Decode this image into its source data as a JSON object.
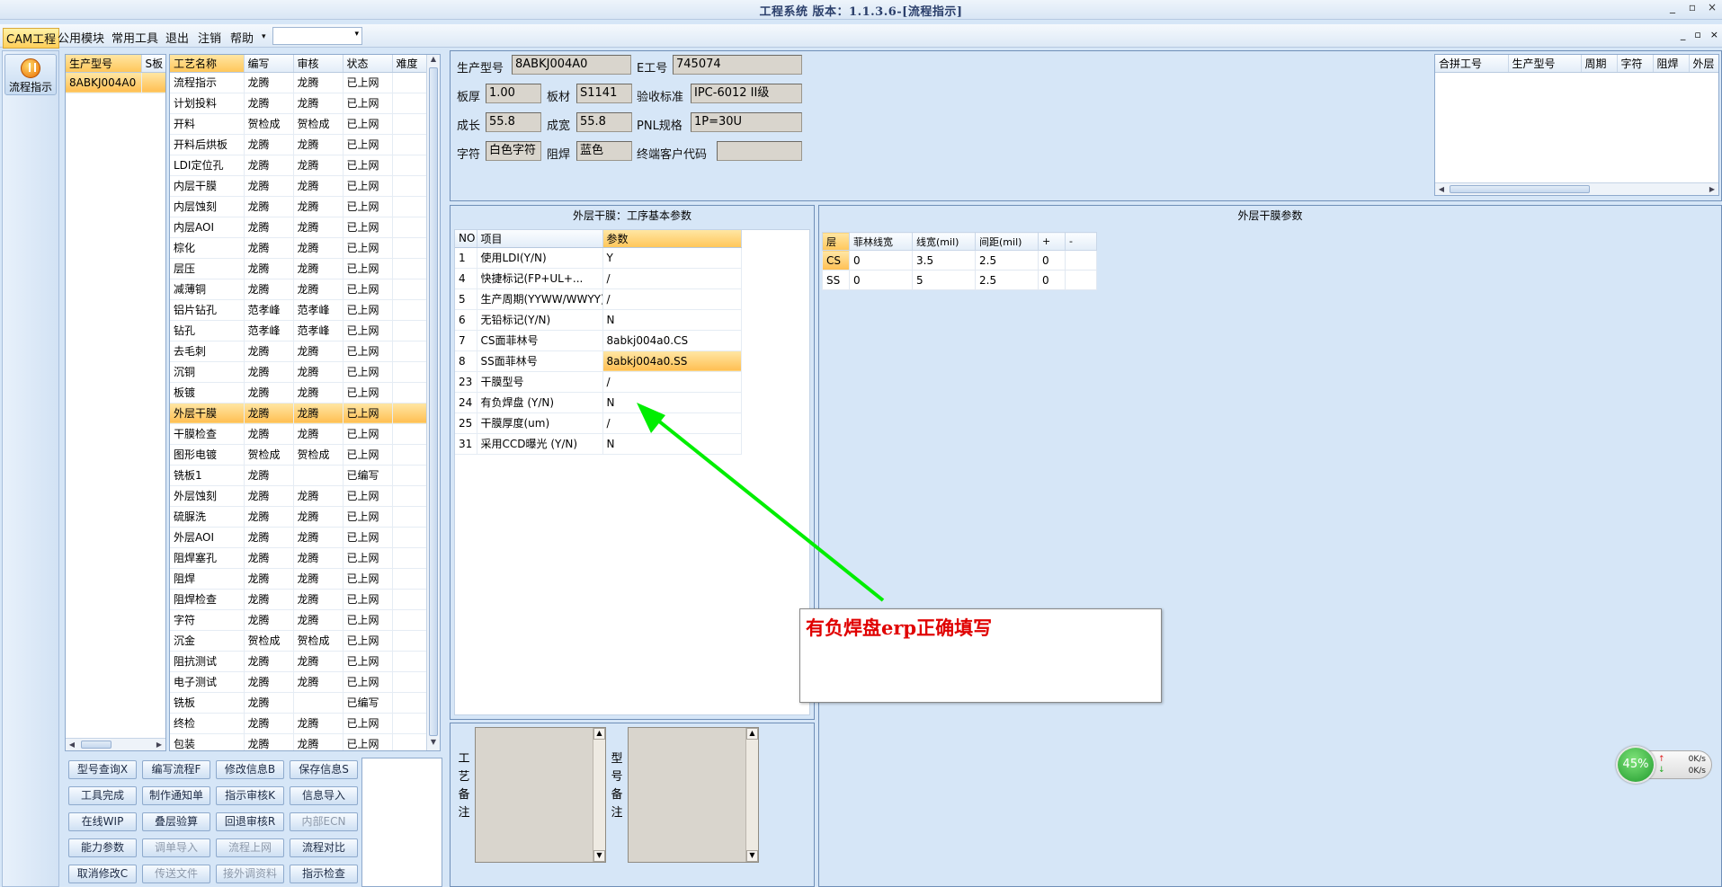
{
  "window": {
    "title": "工程系统 版本：1.1.3.6-[流程指示]",
    "controls": [
      "_",
      "▫",
      "×"
    ],
    "mdi_controls": [
      "_",
      "▫",
      "×"
    ]
  },
  "menu": {
    "items": [
      "CAM工程",
      "公用模块",
      "常用工具",
      "退出",
      "注销",
      "帮助"
    ],
    "help_arrow": "▾",
    "combo_value": "",
    "combo_arrow": "▾"
  },
  "nav": {
    "flow_button": "流程指示"
  },
  "product_list": {
    "headers": [
      "生产型号",
      "S板"
    ],
    "rows": [
      [
        "8ABKJ004A0",
        ""
      ]
    ]
  },
  "process_list": {
    "headers": [
      "工艺名称",
      "编写",
      "审核",
      "状态",
      "难度"
    ],
    "selected_index": 17,
    "rows": [
      [
        "流程指示",
        "龙腾",
        "龙腾",
        "已上网",
        ""
      ],
      [
        "计划投料",
        "龙腾",
        "龙腾",
        "已上网",
        ""
      ],
      [
        "开料",
        "贺检成",
        "贺检成",
        "已上网",
        ""
      ],
      [
        "开料后烘板",
        "龙腾",
        "龙腾",
        "已上网",
        ""
      ],
      [
        "LDI定位孔",
        "龙腾",
        "龙腾",
        "已上网",
        ""
      ],
      [
        "内层干膜",
        "龙腾",
        "龙腾",
        "已上网",
        ""
      ],
      [
        "内层蚀刻",
        "龙腾",
        "龙腾",
        "已上网",
        ""
      ],
      [
        "内层AOI",
        "龙腾",
        "龙腾",
        "已上网",
        ""
      ],
      [
        "棕化",
        "龙腾",
        "龙腾",
        "已上网",
        ""
      ],
      [
        "层压",
        "龙腾",
        "龙腾",
        "已上网",
        ""
      ],
      [
        "减薄铜",
        "龙腾",
        "龙腾",
        "已上网",
        ""
      ],
      [
        "铝片钻孔",
        "范孝峰",
        "范孝峰",
        "已上网",
        ""
      ],
      [
        "钻孔",
        "范孝峰",
        "范孝峰",
        "已上网",
        ""
      ],
      [
        "去毛刺",
        "龙腾",
        "龙腾",
        "已上网",
        ""
      ],
      [
        "沉铜",
        "龙腾",
        "龙腾",
        "已上网",
        ""
      ],
      [
        "板镀",
        "龙腾",
        "龙腾",
        "已上网",
        ""
      ],
      [
        "外层干膜",
        "龙腾",
        "龙腾",
        "已上网",
        ""
      ],
      [
        "干膜检查",
        "龙腾",
        "龙腾",
        "已上网",
        ""
      ],
      [
        "图形电镀",
        "贺检成",
        "贺检成",
        "已上网",
        ""
      ],
      [
        "铣板1",
        "龙腾",
        "",
        "已编写",
        ""
      ],
      [
        "外层蚀刻",
        "龙腾",
        "龙腾",
        "已上网",
        ""
      ],
      [
        "硫脲洗",
        "龙腾",
        "龙腾",
        "已上网",
        ""
      ],
      [
        "外层AOI",
        "龙腾",
        "龙腾",
        "已上网",
        ""
      ],
      [
        "阻焊塞孔",
        "龙腾",
        "龙腾",
        "已上网",
        ""
      ],
      [
        "阻焊",
        "龙腾",
        "龙腾",
        "已上网",
        ""
      ],
      [
        "阻焊检查",
        "龙腾",
        "龙腾",
        "已上网",
        ""
      ],
      [
        "字符",
        "龙腾",
        "龙腾",
        "已上网",
        ""
      ],
      [
        "沉金",
        "贺检成",
        "贺检成",
        "已上网",
        ""
      ],
      [
        "阻抗测试",
        "龙腾",
        "龙腾",
        "已上网",
        ""
      ],
      [
        "电子测试",
        "龙腾",
        "龙腾",
        "已上网",
        ""
      ],
      [
        "铣板",
        "龙腾",
        "",
        "已编写",
        ""
      ],
      [
        "终检",
        "龙腾",
        "龙腾",
        "已上网",
        ""
      ],
      [
        "包装",
        "龙腾",
        "龙腾",
        "已上网",
        ""
      ]
    ]
  },
  "buttons": [
    {
      "label": "型号查询X",
      "disabled": false
    },
    {
      "label": "编写流程F",
      "disabled": false
    },
    {
      "label": "修改信息B",
      "disabled": false
    },
    {
      "label": "保存信息S",
      "disabled": false
    },
    {
      "label": "工具完成",
      "disabled": false
    },
    {
      "label": "制作通知单",
      "disabled": false
    },
    {
      "label": "指示审核K",
      "disabled": false
    },
    {
      "label": "信息导入",
      "disabled": false
    },
    {
      "label": "在线WIP",
      "disabled": false
    },
    {
      "label": "叠层验算",
      "disabled": false
    },
    {
      "label": "回退审核R",
      "disabled": false
    },
    {
      "label": "内部ECN",
      "disabled": true
    },
    {
      "label": "能力参数",
      "disabled": false
    },
    {
      "label": "调单导入",
      "disabled": true
    },
    {
      "label": "流程上网",
      "disabled": true
    },
    {
      "label": "流程对比",
      "disabled": false
    },
    {
      "label": "取消修改C",
      "disabled": false
    },
    {
      "label": "传送文件",
      "disabled": true
    },
    {
      "label": "接外调资料",
      "disabled": true
    },
    {
      "label": "指示检查",
      "disabled": false
    }
  ],
  "info": {
    "model_label": "生产型号",
    "model_value": "8ABKJ004A0",
    "eno_label": "E工号",
    "eno_value": "745074",
    "thickness_label": "板厚",
    "thickness_value": "1.00",
    "material_label": "板材",
    "material_value": "S1141",
    "standard_label": "验收标准",
    "standard_value": "IPC-6012 II级",
    "length_label": "成长",
    "length_value": "55.8",
    "width_label": "成宽",
    "width_value": "55.8",
    "pnl_label": "PNL规格",
    "pnl_value": "1P=30U",
    "char_label": "字符",
    "char_value": "白色字符",
    "mask_label": "阻焊",
    "mask_value": "蓝色",
    "customer_label": "终端客户代码",
    "customer_value": ""
  },
  "merge_grid": {
    "headers": [
      "合拼工号",
      "生产型号",
      "周期",
      "字符",
      "阻焊",
      "外层"
    ]
  },
  "basic_params": {
    "title": "外层干膜：工序基本参数",
    "headers": [
      "NO",
      "项目",
      "参数"
    ],
    "selected_index": 5,
    "rows": [
      [
        "1",
        "使用LDI(Y/N)",
        "Y"
      ],
      [
        "4",
        "快捷标记(FP+UL+...",
        "/"
      ],
      [
        "5",
        "生产周期(YYWW/WWYY)",
        "/"
      ],
      [
        "6",
        "无铅标记(Y/N)",
        "N"
      ],
      [
        "7",
        "CS面菲林号",
        "8abkj004a0.CS"
      ],
      [
        "8",
        "SS面菲林号",
        "8abkj004a0.SS"
      ],
      [
        "23",
        "干膜型号",
        "/"
      ],
      [
        "24",
        "有负焊盘 (Y/N)",
        "N"
      ],
      [
        "25",
        "干膜厚度(um)",
        "/"
      ],
      [
        "31",
        "采用CCD曝光 (Y/N)",
        "N"
      ]
    ]
  },
  "film_params": {
    "title": "外层干膜参数",
    "headers": [
      "层",
      "菲林线宽",
      "线宽(mil)",
      "间距(mil)",
      "+",
      "-"
    ],
    "rows": [
      [
        "CS",
        "0",
        "3.5",
        "2.5",
        "0",
        ""
      ],
      [
        "SS",
        "0",
        "5",
        "2.5",
        "0",
        ""
      ]
    ]
  },
  "remarks": {
    "process_label": "工艺备注",
    "model_label": "型号备注"
  },
  "annotation": {
    "text": "有负焊盘erp正确填写"
  },
  "network": {
    "percent": "45%",
    "up": "0K/s",
    "down": "0K/s"
  },
  "colors": {
    "highlight": "#ffc75b",
    "annotation_text": "#e00000",
    "arrow": "#00ee00"
  }
}
